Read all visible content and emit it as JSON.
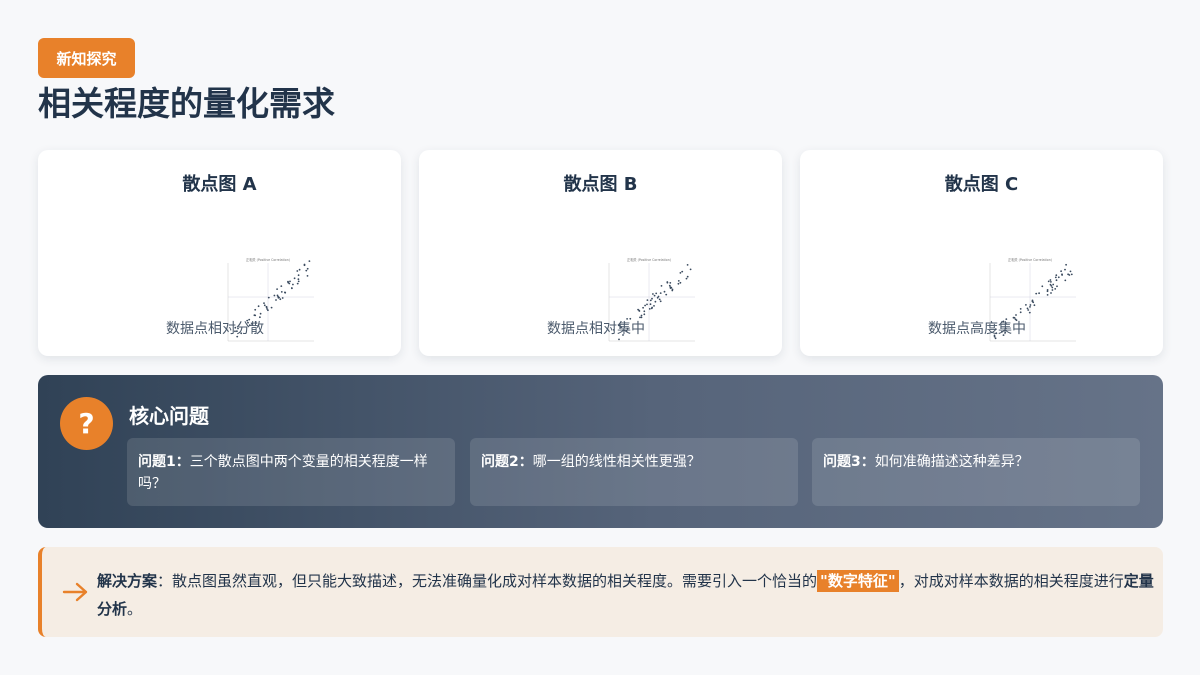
{
  "badge": "新知探究",
  "title": "相关程度的量化需求",
  "cards": [
    {
      "title": "散点图 A",
      "caption": "数据点相对分散",
      "plot_label": "正相关 (Positive Correlation)"
    },
    {
      "title": "散点图 B",
      "caption": "数据点相对集中",
      "plot_label": "正相关 (Positive Correlation)"
    },
    {
      "title": "散点图 C",
      "caption": "数据点高度集中",
      "plot_label": "正相关 (Positive Correlation)"
    }
  ],
  "core": {
    "icon": "question-icon",
    "icon_glyph": "?",
    "title": "核心问题",
    "questions": [
      {
        "label": "问题1：",
        "text": "三个散点图中两个变量的相关程度一样吗？"
      },
      {
        "label": "问题2：",
        "text": "哪一组的线性相关性更强？"
      },
      {
        "label": "问题3：",
        "text": "如何准确描述这种差异？"
      }
    ]
  },
  "solution": {
    "icon": "arrow-right-icon",
    "label": "解决方案",
    "colon": "：",
    "text1": "散点图虽然直观，但只能大致描述，无法准确量化成对样本数据的相关程度。需要引入一个恰当的",
    "highlight": "\"数字特征\"",
    "text2": "，对成对样本数据的相关程度进行",
    "emphasis": "定量分析",
    "end": "。"
  },
  "colors": {
    "accent": "#e8812a",
    "title": "#22344a",
    "panel": "#304256"
  }
}
